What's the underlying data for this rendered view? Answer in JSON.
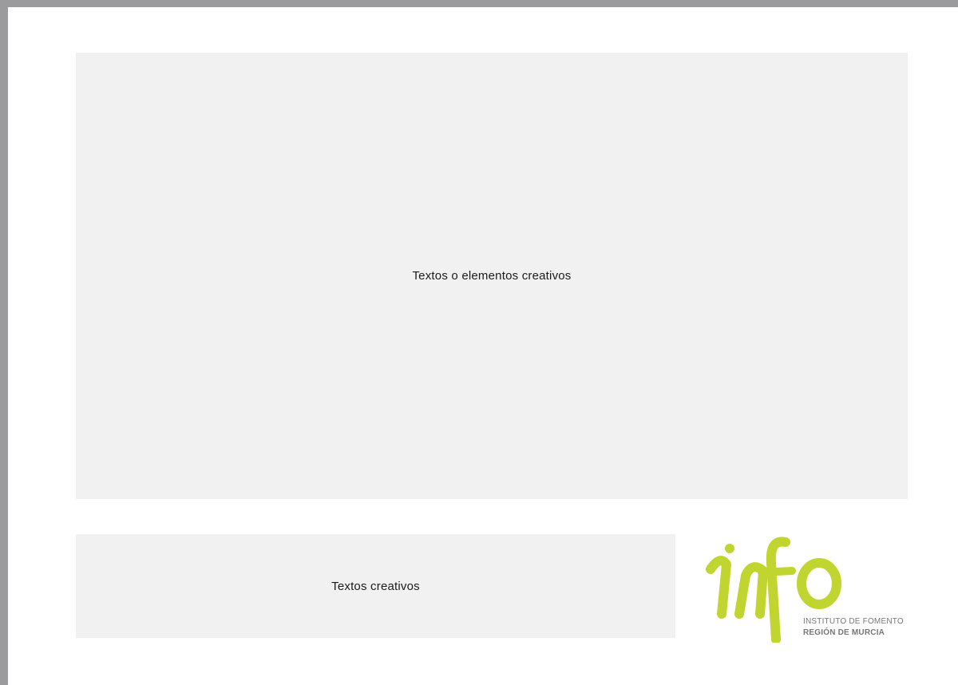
{
  "main_placeholder": {
    "text": "Textos o elementos creativos"
  },
  "secondary_placeholder": {
    "text": "Textos creativos"
  },
  "logo": {
    "wordmark": "info",
    "line1": "INSTITUTO DE FOMENTO",
    "line2": "REGIÓN DE MURCIA",
    "color": "#c0d52f",
    "text_color": "#777777"
  },
  "colors": {
    "background": "#9b9b9e",
    "page": "#ffffff",
    "placeholder_fill": "#f1f1f1"
  }
}
